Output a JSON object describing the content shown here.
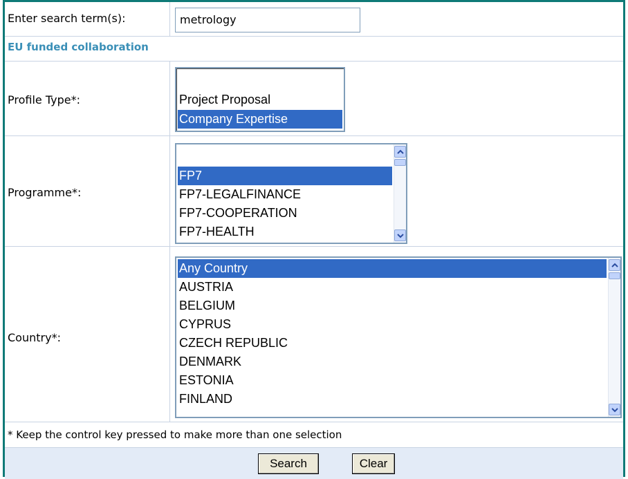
{
  "search": {
    "label": "Enter search term(s):",
    "value": "metrology"
  },
  "section": {
    "title": "EU funded collaboration"
  },
  "profile_type": {
    "label": "Profile Type*:",
    "options": [
      {
        "text": "",
        "selected": false
      },
      {
        "text": "Project Proposal",
        "selected": false
      },
      {
        "text": "Company Expertise",
        "selected": true
      }
    ]
  },
  "programme": {
    "label": "Programme*:",
    "options": [
      {
        "text": "",
        "selected": false
      },
      {
        "text": "FP7",
        "selected": true
      },
      {
        "text": "FP7-LEGALFINANCE",
        "selected": false
      },
      {
        "text": "FP7-COOPERATION",
        "selected": false
      },
      {
        "text": "FP7-HEALTH",
        "selected": false
      }
    ]
  },
  "country": {
    "label": "Country*:",
    "options": [
      {
        "text": "Any Country",
        "selected": true
      },
      {
        "text": "AUSTRIA",
        "selected": false
      },
      {
        "text": "BELGIUM",
        "selected": false
      },
      {
        "text": "CYPRUS",
        "selected": false
      },
      {
        "text": "CZECH REPUBLIC",
        "selected": false
      },
      {
        "text": "DENMARK",
        "selected": false
      },
      {
        "text": "ESTONIA",
        "selected": false
      },
      {
        "text": "FINLAND",
        "selected": false
      }
    ]
  },
  "hint": "* Keep the control key pressed to make more than one selection",
  "buttons": {
    "search": "Search",
    "clear": "Clear"
  },
  "colors": {
    "frame": "#0f7a77",
    "section_title": "#3a8fb7",
    "selection": "#316ac5",
    "footer_bg": "#e3ebf7"
  }
}
